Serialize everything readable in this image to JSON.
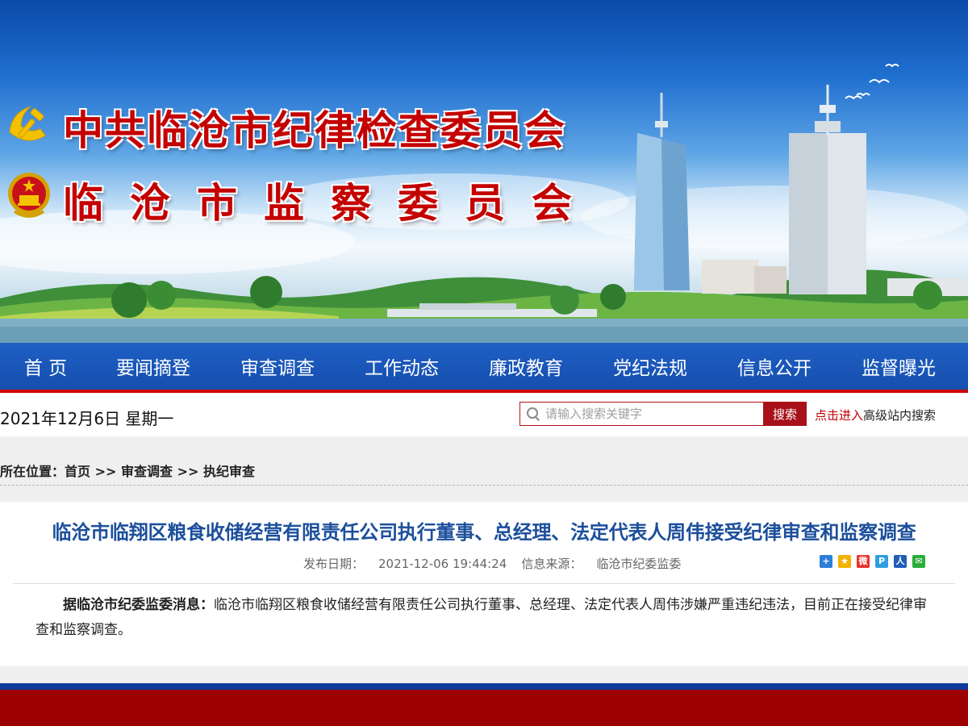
{
  "banner": {
    "title_line1": "中共临沧市纪律检查委员会",
    "title_line2": "临沧市监察委员会"
  },
  "nav": {
    "items": [
      {
        "label": "首 页"
      },
      {
        "label": "要闻摘登"
      },
      {
        "label": "审查调查"
      },
      {
        "label": "工作动态"
      },
      {
        "label": "廉政教育"
      },
      {
        "label": "党纪法规"
      },
      {
        "label": "信息公开"
      },
      {
        "label": "监督曝光"
      }
    ]
  },
  "date_text": "2021年12月6日 星期一",
  "search": {
    "placeholder": "请输入搜索关键字",
    "button_label": "搜索",
    "advanced_link": "点击进入",
    "advanced_text": "高级站内搜索"
  },
  "breadcrumb": {
    "label": "所在位置：",
    "items": [
      "首页",
      "审查调查",
      "执纪审查"
    ],
    "separator": " >> "
  },
  "article": {
    "title": "临沧市临翔区粮食收储经营有限责任公司执行董事、总经理、法定代表人周伟接受纪律审查和监察调查",
    "date_label": "发布日期：",
    "date_value": "2021-12-06 19:44:24",
    "source_label": "信息来源：",
    "source_value": "临沧市纪委监委",
    "body_lead": "据临沧市纪委监委消息：",
    "body_text": "临沧市临翔区粮食收储经营有限责任公司执行董事、总经理、法定代表人周伟涉嫌严重违纪违法，目前正在接受纪律审查和监察调查。"
  },
  "share": {
    "icons": [
      {
        "name": "share-more-icon",
        "glyph": "+",
        "color": "#2c7fd6"
      },
      {
        "name": "qzone-icon",
        "glyph": "★",
        "color": "#f2b200"
      },
      {
        "name": "weibo-icon",
        "glyph": "微",
        "color": "#e8332b"
      },
      {
        "name": "tencent-weibo-icon",
        "glyph": "P",
        "color": "#2f9fe0"
      },
      {
        "name": "renren-icon",
        "glyph": "人",
        "color": "#1f5fb8"
      },
      {
        "name": "wechat-icon",
        "glyph": "✉",
        "color": "#2aae3a"
      }
    ]
  },
  "colors": {
    "nav_blue": "#1a56b8",
    "accent_red": "#a8111a",
    "title_blue": "#1c4f9c",
    "footer_red": "#9c0000"
  }
}
